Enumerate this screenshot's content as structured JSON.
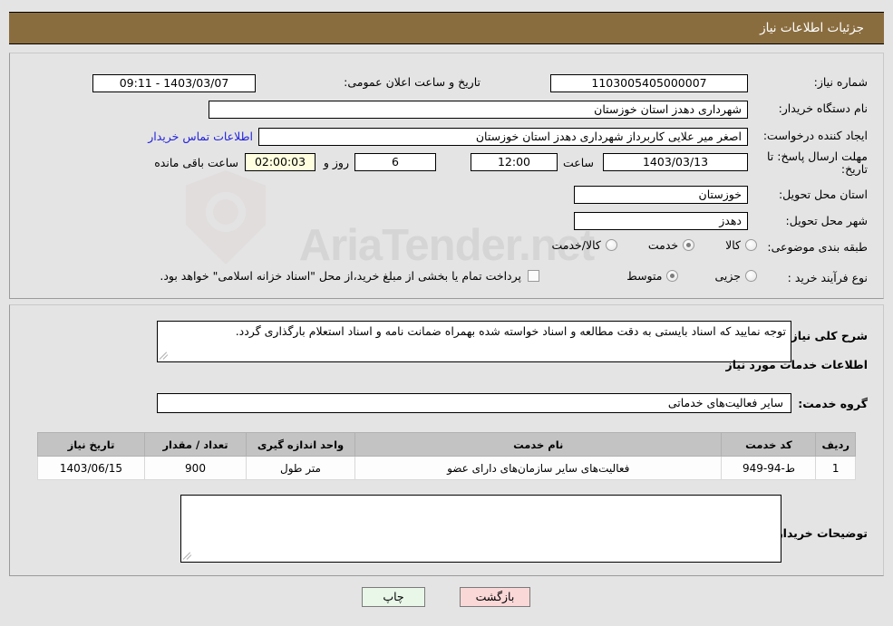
{
  "header": {
    "title": "جزئیات اطلاعات نیاز"
  },
  "watermark": {
    "text": "AriaTender.net"
  },
  "form": {
    "need_number_label": "شماره نیاز:",
    "need_number_value": "1103005405000007",
    "public_announce_label": "تاریخ و ساعت اعلان عمومی:",
    "public_announce_value": "1403/03/07 - 09:11",
    "buyer_org_label": "نام دستگاه خریدار:",
    "buyer_org_value": "شهرداری دهدز استان خوزستان",
    "creator_label": "ایجاد کننده درخواست:",
    "creator_value": "اصغر میر علایی کاربرداز شهرداری دهدز استان خوزستان",
    "contact_link": "اطلاعات تماس خریدار",
    "deadline_label": "مهلت ارسال پاسخ: تا تاریخ:",
    "deadline_date": "1403/03/13",
    "hour_label": "ساعت",
    "deadline_time": "12:00",
    "days_value": "6",
    "days_label": "روز و",
    "remaining_time": "02:00:03",
    "remaining_label": "ساعت باقی مانده",
    "province_label": "استان محل تحویل:",
    "province_value": "خوزستان",
    "city_label": "شهر محل تحویل:",
    "city_value": "دهدز",
    "category_label": "طبقه بندی موضوعی:",
    "category_options": [
      {
        "label": "کالا",
        "selected": false
      },
      {
        "label": "خدمت",
        "selected": true
      },
      {
        "label": "کالا/خدمت",
        "selected": false
      }
    ],
    "purchase_type_label": "نوع فرآیند خرید :",
    "purchase_type_options": [
      {
        "label": "جزیی",
        "selected": false
      },
      {
        "label": "متوسط",
        "selected": true
      }
    ],
    "treasury_checkbox_label": "پرداخت تمام یا بخشی از مبلغ خرید،از محل \"اسناد خزانه اسلامی\" خواهد بود.",
    "treasury_checked": false
  },
  "description": {
    "label": "شرح کلی نیاز:",
    "value": "توجه نمایید که اسناد بایستی به دقت مطالعه و اسناد خواسته شده بهمراه ضمانت نامه و اسناد استعلام بارگذاری گردد."
  },
  "services": {
    "section_title": "اطلاعات خدمات مورد نیاز",
    "group_label": "گروه خدمت:",
    "group_value": "سایر فعالیت‌های خدماتی",
    "table": {
      "columns": [
        "ردیف",
        "کد خدمت",
        "نام خدمت",
        "واحد اندازه گیری",
        "تعداد / مقدار",
        "تاریخ نیاز"
      ],
      "rows": [
        [
          "1",
          "ط-94-949",
          "فعالیت‌های سایر سازمان‌های دارای عضو",
          "متر طول",
          "900",
          "1403/06/15"
        ]
      ]
    }
  },
  "buyer_comments": {
    "label": "توضیحات خریدار:",
    "value": ""
  },
  "footer": {
    "print_label": "چاپ",
    "back_label": "بازگشت"
  }
}
